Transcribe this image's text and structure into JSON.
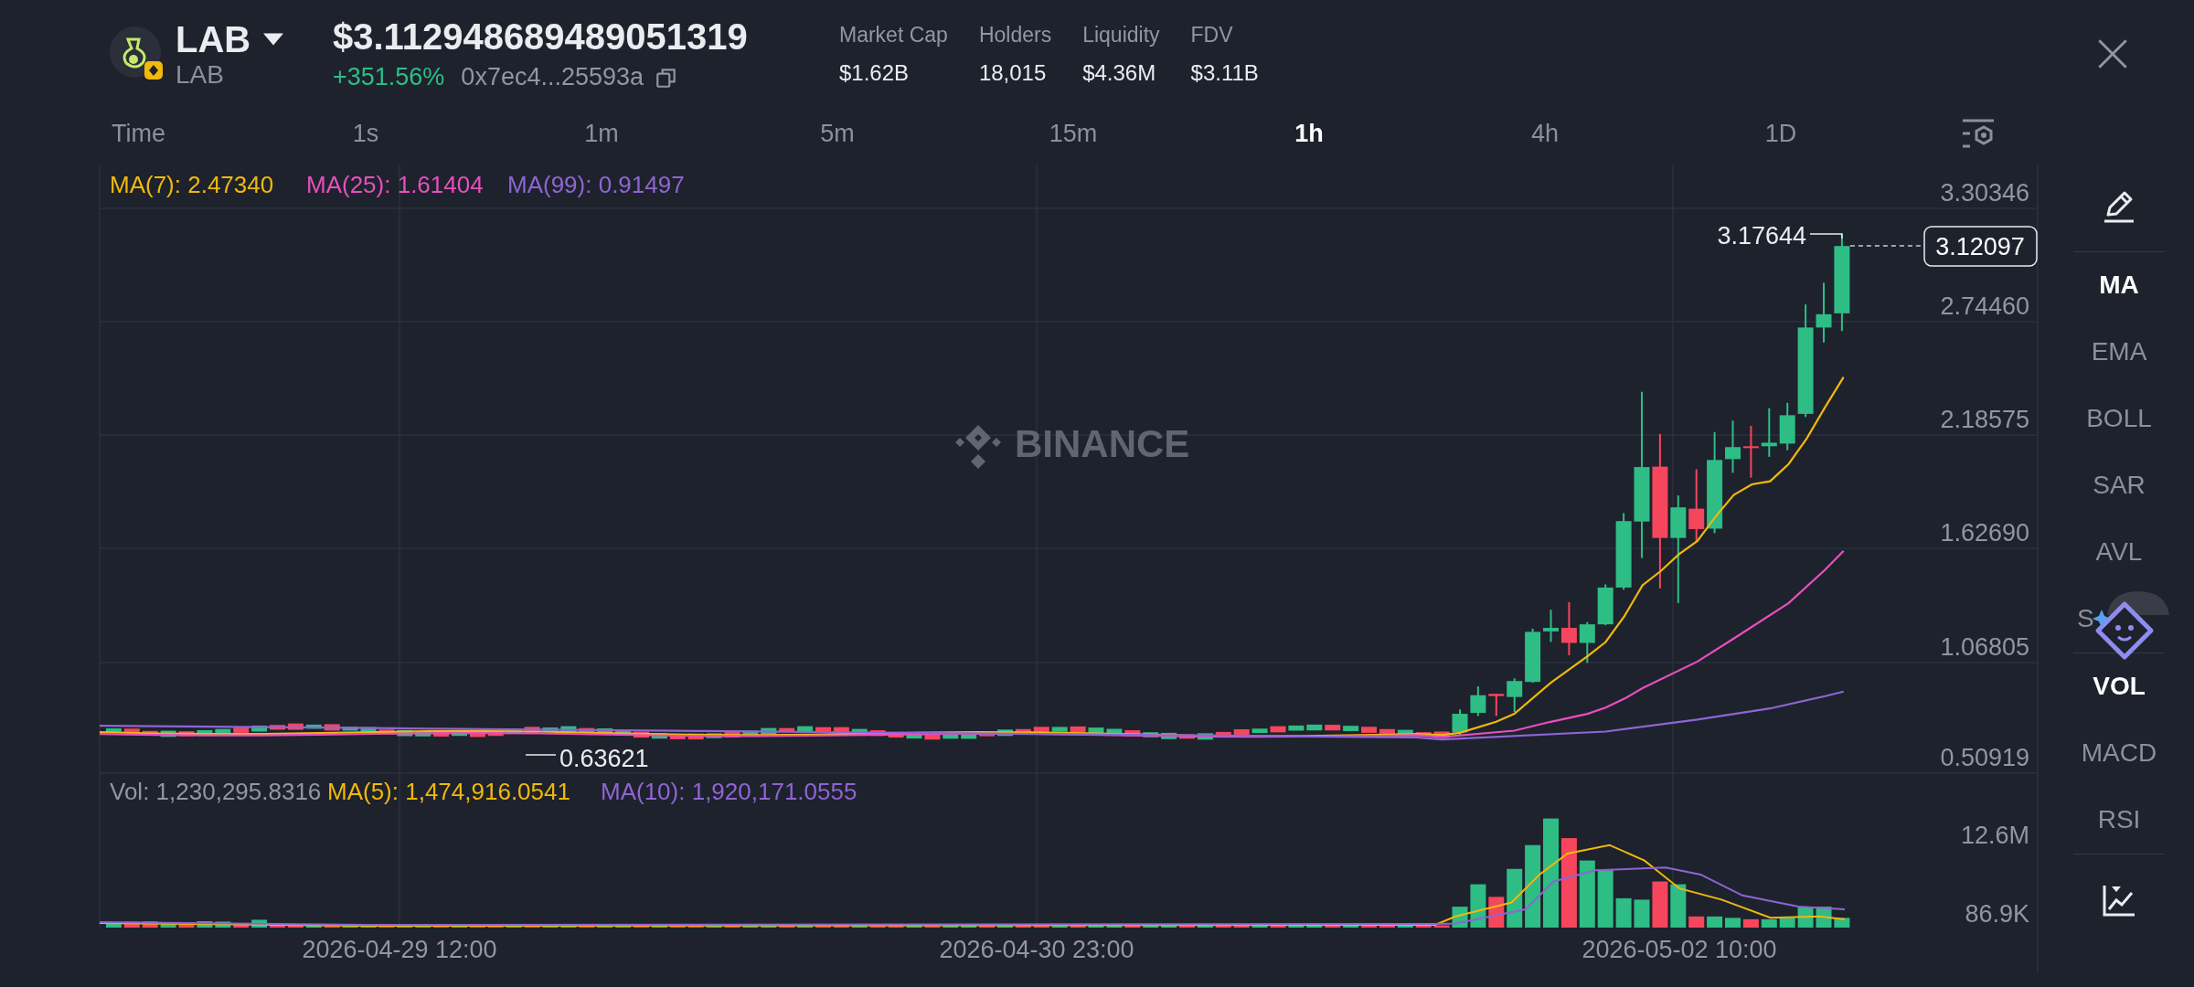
{
  "token": {
    "symbol": "LAB",
    "name": "LAB",
    "price": "$3.112948689489051319",
    "change": "+351.56%",
    "address": "0x7ec4...25593a"
  },
  "stats": [
    {
      "label": "Market Cap",
      "value": "$1.62B"
    },
    {
      "label": "Holders",
      "value": "18,015"
    },
    {
      "label": "Liquidity",
      "value": "$4.36M"
    },
    {
      "label": "FDV",
      "value": "$3.11B"
    }
  ],
  "intervals": [
    {
      "label": "Time",
      "selected": false
    },
    {
      "label": "1s",
      "selected": false
    },
    {
      "label": "1m",
      "selected": false
    },
    {
      "label": "5m",
      "selected": false
    },
    {
      "label": "15m",
      "selected": false
    },
    {
      "label": "1h",
      "selected": true
    },
    {
      "label": "4h",
      "selected": false
    },
    {
      "label": "1D",
      "selected": false
    }
  ],
  "chart": {
    "ma_legend": [
      {
        "label": "MA(7): 2.47340",
        "color": "#f0b90b"
      },
      {
        "label": "MA(25): 1.61404",
        "color": "#e84fbf"
      },
      {
        "label": "MA(99): 0.91497",
        "color": "#8f65d3"
      }
    ],
    "price_ticks": [
      "3.30346",
      "2.74460",
      "2.18575",
      "1.62690",
      "1.06805",
      "0.50919"
    ],
    "high_label": "3.17644",
    "low_label": "0.63621",
    "last_price": "3.12097",
    "watermark": "BINANCE",
    "volume_legend": [
      {
        "label": "Vol: 1,230,295.8316",
        "color": "#9097a3"
      },
      {
        "label": "MA(5): 1,474,916.0541",
        "color": "#f0b90b"
      },
      {
        "label": "MA(10): 1,920,171.0555",
        "color": "#8f65d3"
      }
    ],
    "volume_ticks": [
      "12.6M",
      "86.9K"
    ],
    "time_labels": [
      "2026-04-29 12:00",
      "2026-04-30 23:00",
      "2026-05-02 10:00"
    ]
  },
  "indicators": {
    "main": [
      {
        "label": "MA",
        "selected": true
      },
      {
        "label": "EMA",
        "selected": false
      },
      {
        "label": "BOLL",
        "selected": false
      },
      {
        "label": "SAR",
        "selected": false
      },
      {
        "label": "AVL",
        "selected": false
      },
      {
        "label": "S",
        "selected": false
      }
    ],
    "sub": [
      {
        "label": "VOL",
        "selected": true
      },
      {
        "label": "MACD",
        "selected": false
      },
      {
        "label": "RSI",
        "selected": false
      }
    ]
  }
}
